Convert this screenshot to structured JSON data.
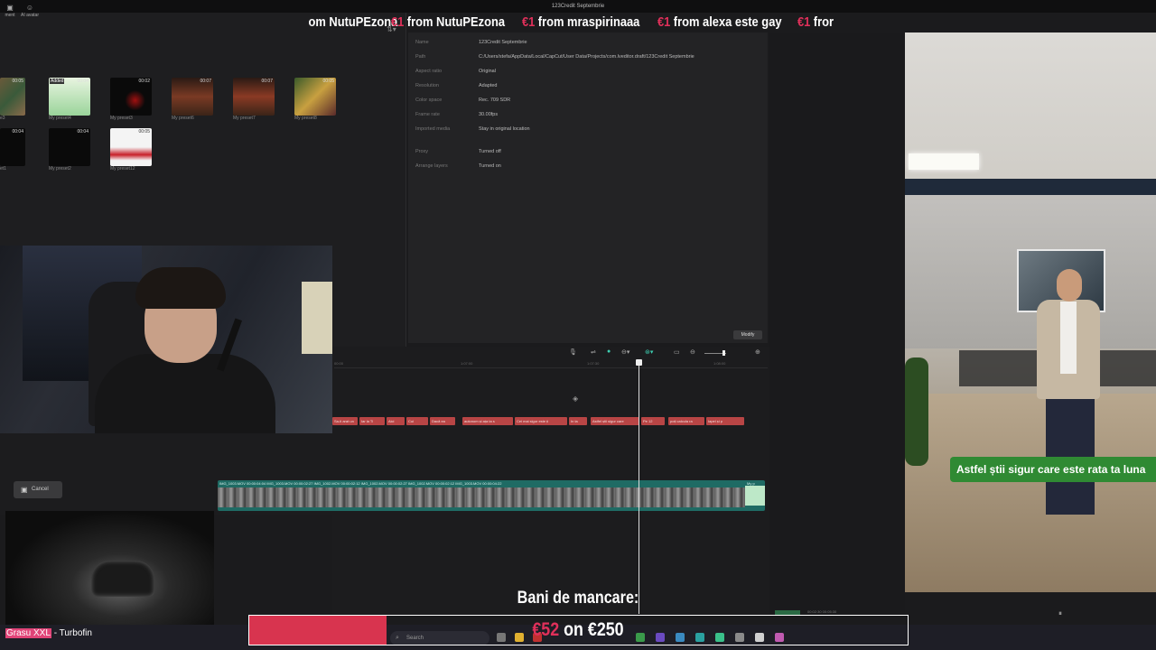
{
  "window": {
    "title": "123Credit Septembrie"
  },
  "ticker": [
    {
      "amount": "",
      "text": "om NutuPEzona"
    },
    {
      "amount": "€1",
      "text": "from NutuPEzona"
    },
    {
      "amount": "€1",
      "text": "from mraspirinaaa"
    },
    {
      "amount": "€1",
      "text": "from alexa este gay"
    },
    {
      "amount": "€1",
      "text": "fror"
    }
  ],
  "media_toolbar": {
    "items": [
      {
        "label": "ment",
        "icon": "media-icon"
      },
      {
        "label": "AI avatar",
        "icon": "avatar-icon"
      }
    ]
  },
  "media_items": [
    {
      "label": "e3",
      "duration": "00:05"
    },
    {
      "label": "My preset4",
      "duration": "00:04",
      "badge": "Added"
    },
    {
      "label": "My preset3",
      "duration": "00:02"
    },
    {
      "label": "My preset6",
      "duration": "00:07"
    },
    {
      "label": "My preset7",
      "duration": "00:07"
    },
    {
      "label": "My preset8",
      "duration": "00:05"
    },
    {
      "label": "et1",
      "duration": "00:04"
    },
    {
      "label": "My preset2",
      "duration": "00:04"
    },
    {
      "label": "My preset12",
      "duration": "00:05"
    }
  ],
  "details": {
    "rows": [
      {
        "key": "Name",
        "value": "123Credit Septembrie"
      },
      {
        "key": "Path",
        "value": "C:/Users/stefa/AppData/Local/CapCut/User Data/Projects/com.lveditor.draft/123Credit Septembrie"
      },
      {
        "key": "Aspect ratio",
        "value": "Original"
      },
      {
        "key": "Resolution",
        "value": "Adapted"
      },
      {
        "key": "Color space",
        "value": "Rec. 709 SDR"
      },
      {
        "key": "Frame rate",
        "value": "30.00fps"
      },
      {
        "key": "Imported media",
        "value": "Stay in original location"
      },
      {
        "key": "Proxy",
        "value": "Turned off"
      },
      {
        "key": "Arrange layers",
        "value": "Turned on"
      }
    ],
    "modify_label": "Modify"
  },
  "timeline": {
    "ruler": [
      "00:00",
      "1:07:00",
      "1:07:30",
      "1:08:00"
    ],
    "captions": [
      "Sa-ti arat un",
      "Iar la Ti",
      "Aici",
      "Cui",
      "Dacă ea",
      "autonom și ața ta s",
      "Cei mai sigur este ți",
      "In ta",
      "Astfel știi sigur care",
      "Pe 12",
      "poți calcula ra",
      "Iapel și p"
    ],
    "video_label": "IMG_1003.MOV  00:00:04:04   IMG_1003.MOV  00:00:02:27   IMG_1002.MOV  00:00:02:12   IMG_1002.MOV  00:00:02:27   IMG_1002.MOV  00:00:02:12   IMG_1003.MOV  00:00:04:22",
    "video_end_label": "My p",
    "cancel_label": "Cancel"
  },
  "player": {
    "subtitle": "Astfel știi sigur care este rata ta luna",
    "time_readout": "00:02:30  00:05:30"
  },
  "taskbar": {
    "search_placeholder": "Search"
  },
  "overlay": {
    "song_highlight": "Grasu XXL",
    "song_rest": " - Turbofin",
    "goal_title": "Bani de mancare:",
    "goal_current": "€52",
    "goal_middle": " on ",
    "goal_target": "€250",
    "goal_progress": 0.208
  },
  "colors": {
    "accent": "#d8344f",
    "caption_track": "#b84545",
    "video_track": "#1f6b64",
    "subtitle_bg": "#2f8a33"
  }
}
